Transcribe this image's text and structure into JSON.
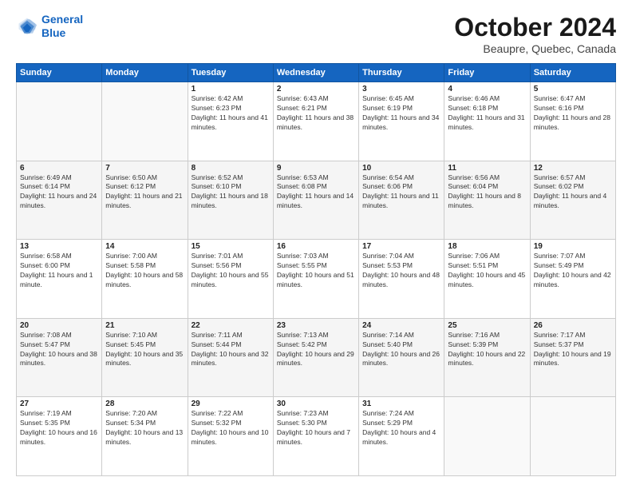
{
  "header": {
    "logo_line1": "General",
    "logo_line2": "Blue",
    "month_title": "October 2024",
    "location": "Beaupre, Quebec, Canada"
  },
  "days_of_week": [
    "Sunday",
    "Monday",
    "Tuesday",
    "Wednesday",
    "Thursday",
    "Friday",
    "Saturday"
  ],
  "weeks": [
    [
      {
        "day": "",
        "info": ""
      },
      {
        "day": "",
        "info": ""
      },
      {
        "day": "1",
        "info": "Sunrise: 6:42 AM\nSunset: 6:23 PM\nDaylight: 11 hours and 41 minutes."
      },
      {
        "day": "2",
        "info": "Sunrise: 6:43 AM\nSunset: 6:21 PM\nDaylight: 11 hours and 38 minutes."
      },
      {
        "day": "3",
        "info": "Sunrise: 6:45 AM\nSunset: 6:19 PM\nDaylight: 11 hours and 34 minutes."
      },
      {
        "day": "4",
        "info": "Sunrise: 6:46 AM\nSunset: 6:18 PM\nDaylight: 11 hours and 31 minutes."
      },
      {
        "day": "5",
        "info": "Sunrise: 6:47 AM\nSunset: 6:16 PM\nDaylight: 11 hours and 28 minutes."
      }
    ],
    [
      {
        "day": "6",
        "info": "Sunrise: 6:49 AM\nSunset: 6:14 PM\nDaylight: 11 hours and 24 minutes."
      },
      {
        "day": "7",
        "info": "Sunrise: 6:50 AM\nSunset: 6:12 PM\nDaylight: 11 hours and 21 minutes."
      },
      {
        "day": "8",
        "info": "Sunrise: 6:52 AM\nSunset: 6:10 PM\nDaylight: 11 hours and 18 minutes."
      },
      {
        "day": "9",
        "info": "Sunrise: 6:53 AM\nSunset: 6:08 PM\nDaylight: 11 hours and 14 minutes."
      },
      {
        "day": "10",
        "info": "Sunrise: 6:54 AM\nSunset: 6:06 PM\nDaylight: 11 hours and 11 minutes."
      },
      {
        "day": "11",
        "info": "Sunrise: 6:56 AM\nSunset: 6:04 PM\nDaylight: 11 hours and 8 minutes."
      },
      {
        "day": "12",
        "info": "Sunrise: 6:57 AM\nSunset: 6:02 PM\nDaylight: 11 hours and 4 minutes."
      }
    ],
    [
      {
        "day": "13",
        "info": "Sunrise: 6:58 AM\nSunset: 6:00 PM\nDaylight: 11 hours and 1 minute."
      },
      {
        "day": "14",
        "info": "Sunrise: 7:00 AM\nSunset: 5:58 PM\nDaylight: 10 hours and 58 minutes."
      },
      {
        "day": "15",
        "info": "Sunrise: 7:01 AM\nSunset: 5:56 PM\nDaylight: 10 hours and 55 minutes."
      },
      {
        "day": "16",
        "info": "Sunrise: 7:03 AM\nSunset: 5:55 PM\nDaylight: 10 hours and 51 minutes."
      },
      {
        "day": "17",
        "info": "Sunrise: 7:04 AM\nSunset: 5:53 PM\nDaylight: 10 hours and 48 minutes."
      },
      {
        "day": "18",
        "info": "Sunrise: 7:06 AM\nSunset: 5:51 PM\nDaylight: 10 hours and 45 minutes."
      },
      {
        "day": "19",
        "info": "Sunrise: 7:07 AM\nSunset: 5:49 PM\nDaylight: 10 hours and 42 minutes."
      }
    ],
    [
      {
        "day": "20",
        "info": "Sunrise: 7:08 AM\nSunset: 5:47 PM\nDaylight: 10 hours and 38 minutes."
      },
      {
        "day": "21",
        "info": "Sunrise: 7:10 AM\nSunset: 5:45 PM\nDaylight: 10 hours and 35 minutes."
      },
      {
        "day": "22",
        "info": "Sunrise: 7:11 AM\nSunset: 5:44 PM\nDaylight: 10 hours and 32 minutes."
      },
      {
        "day": "23",
        "info": "Sunrise: 7:13 AM\nSunset: 5:42 PM\nDaylight: 10 hours and 29 minutes."
      },
      {
        "day": "24",
        "info": "Sunrise: 7:14 AM\nSunset: 5:40 PM\nDaylight: 10 hours and 26 minutes."
      },
      {
        "day": "25",
        "info": "Sunrise: 7:16 AM\nSunset: 5:39 PM\nDaylight: 10 hours and 22 minutes."
      },
      {
        "day": "26",
        "info": "Sunrise: 7:17 AM\nSunset: 5:37 PM\nDaylight: 10 hours and 19 minutes."
      }
    ],
    [
      {
        "day": "27",
        "info": "Sunrise: 7:19 AM\nSunset: 5:35 PM\nDaylight: 10 hours and 16 minutes."
      },
      {
        "day": "28",
        "info": "Sunrise: 7:20 AM\nSunset: 5:34 PM\nDaylight: 10 hours and 13 minutes."
      },
      {
        "day": "29",
        "info": "Sunrise: 7:22 AM\nSunset: 5:32 PM\nDaylight: 10 hours and 10 minutes."
      },
      {
        "day": "30",
        "info": "Sunrise: 7:23 AM\nSunset: 5:30 PM\nDaylight: 10 hours and 7 minutes."
      },
      {
        "day": "31",
        "info": "Sunrise: 7:24 AM\nSunset: 5:29 PM\nDaylight: 10 hours and 4 minutes."
      },
      {
        "day": "",
        "info": ""
      },
      {
        "day": "",
        "info": ""
      }
    ]
  ]
}
